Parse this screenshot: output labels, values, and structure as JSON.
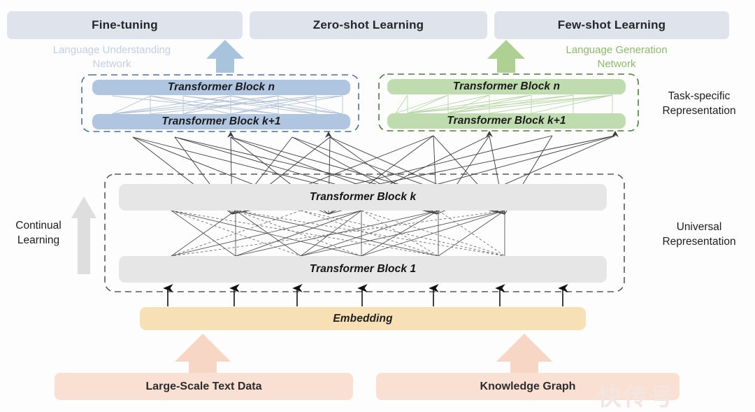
{
  "diagram": {
    "title_tasks": [
      {
        "label": "Fine-tuning"
      },
      {
        "label": "Zero-shot Learning"
      },
      {
        "label": "Few-shot Learning"
      }
    ],
    "network_captions": {
      "understanding": "Language Understanding\nNetwork",
      "understanding_line1": "Language Understanding",
      "understanding_line2": "Network",
      "generation_line1": "Language Generation",
      "generation_line2": "Network"
    },
    "task_specific": {
      "blue_blocks": [
        {
          "label": "Transformer Block n"
        },
        {
          "label": "Transformer Block k+1"
        }
      ],
      "green_blocks": [
        {
          "label": "Transformer Block n"
        },
        {
          "label": "Transformer Block k+1"
        }
      ],
      "side_label_line1": "Task-specific",
      "side_label_line2": "Representation"
    },
    "universal": {
      "blocks": [
        {
          "label": "Transformer Block k"
        },
        {
          "label": "Transformer Block 1"
        }
      ],
      "side_label_line1": "Universal",
      "side_label_line2": "Representation"
    },
    "continual": {
      "line1": "Continual",
      "line2": "Learning"
    },
    "embedding": {
      "label": "Embedding"
    },
    "data_sources": [
      {
        "label": "Large-Scale Text Data"
      },
      {
        "label": "Knowledge Graph"
      }
    ],
    "watermark": "快传号",
    "colors": {
      "task_box_bg": "#dfe3ec",
      "data_box_bg": "#fae0d2",
      "blue_bar": "#b0c5e0",
      "green_bar": "#bfdcae",
      "gray_bar": "#e6e6e6",
      "embed_bar": "#f7e0b5",
      "blue_dash": "#4a6fa8",
      "green_dash": "#4e7b3c",
      "gray_dash": "#555a60",
      "blue_arrow": "#a8c4dd",
      "green_arrow": "#aed193",
      "pink_arrow": "#f7d6c5",
      "gray_arrow": "#dcdcdc"
    }
  }
}
